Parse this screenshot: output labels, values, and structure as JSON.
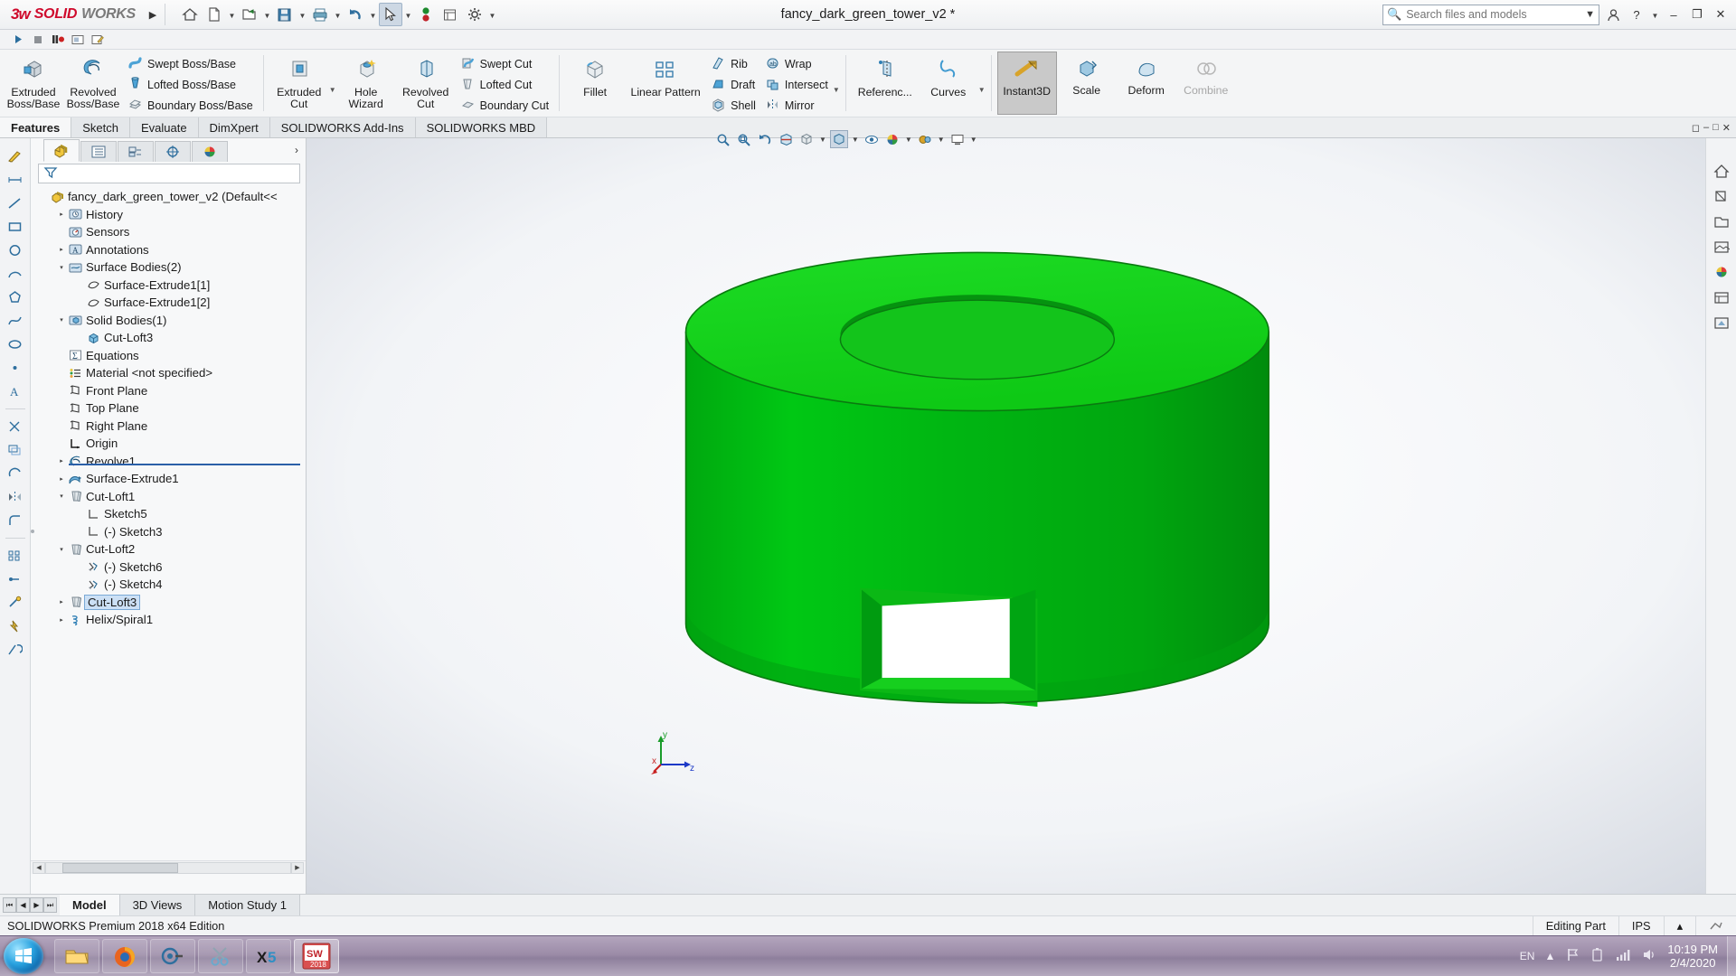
{
  "titlebar": {
    "brand_ds": "35",
    "brand_solid": "SOLID",
    "brand_works": "WORKS",
    "document_title": "fancy_dark_green_tower_v2 *",
    "icons": [
      "home-icon",
      "new-document-icon",
      "open-folder-icon",
      "save-icon",
      "print-icon",
      "undo-icon",
      "select-pointer-icon",
      "stop-record-icon",
      "display-icon",
      "options-gear-icon"
    ],
    "search_placeholder": "Search files and models",
    "user_label": "",
    "help_label": "?",
    "minimize": "–",
    "maximize": "❐",
    "close": "✕"
  },
  "minibar": {
    "icons": [
      "play-icon",
      "stop-icon",
      "pause-record-icon",
      "screen-capture-icon",
      "edit-macro-icon"
    ]
  },
  "ribbon": {
    "groups": [
      {
        "name": "features-create",
        "big": [
          {
            "label_line1": "Extruded",
            "label_line2": "Boss/Base",
            "icon": "extruded-boss-icon"
          },
          {
            "label_line1": "Revolved",
            "label_line2": "Boss/Base",
            "icon": "revolved-boss-icon"
          }
        ],
        "small": [
          {
            "label": "Swept Boss/Base",
            "icon": "swept-boss-icon"
          },
          {
            "label": "Lofted Boss/Base",
            "icon": "lofted-boss-icon"
          },
          {
            "label": "Boundary Boss/Base",
            "icon": "boundary-boss-icon"
          }
        ]
      },
      {
        "name": "features-cut",
        "big": [
          {
            "label_line1": "Extruded",
            "label_line2": "Cut",
            "icon": "extruded-cut-icon"
          },
          {
            "label_line1": "Hole Wizard",
            "label_line2": "",
            "icon": "hole-wizard-icon"
          },
          {
            "label_line1": "Revolved",
            "label_line2": "Cut",
            "icon": "revolved-cut-icon"
          }
        ],
        "small": [
          {
            "label": "Swept Cut",
            "icon": "swept-cut-icon"
          },
          {
            "label": "Lofted Cut",
            "icon": "lofted-cut-icon"
          },
          {
            "label": "Boundary Cut",
            "icon": "boundary-cut-icon"
          }
        ]
      },
      {
        "name": "features-modify",
        "big": [
          {
            "label_line1": "Fillet",
            "label_line2": "",
            "icon": "fillet-icon"
          },
          {
            "label_line1": "Linear Pattern",
            "label_line2": "",
            "icon": "linear-pattern-icon"
          }
        ],
        "small": [
          {
            "label": "Rib",
            "icon": "rib-icon"
          },
          {
            "label": "Draft",
            "icon": "draft-icon"
          },
          {
            "label": "Shell",
            "icon": "shell-icon"
          }
        ],
        "small2": [
          {
            "label": "Wrap",
            "icon": "wrap-icon"
          },
          {
            "label": "Intersect",
            "icon": "intersect-icon"
          },
          {
            "label": "Mirror",
            "icon": "mirror-icon"
          }
        ]
      },
      {
        "name": "features-reference",
        "big": [
          {
            "label_line1": "Referenc...",
            "label_line2": "",
            "icon": "reference-geometry-icon"
          },
          {
            "label_line1": "Curves",
            "label_line2": "",
            "icon": "curves-icon"
          }
        ],
        "small": []
      },
      {
        "name": "features-direct",
        "big": [
          {
            "label_line1": "Instant3D",
            "label_line2": "",
            "icon": "instant3d-icon",
            "selected": true
          },
          {
            "label_line1": "Scale",
            "label_line2": "",
            "icon": "scale-icon"
          },
          {
            "label_line1": "Deform",
            "label_line2": "",
            "icon": "deform-icon"
          },
          {
            "label_line1": "Combine",
            "label_line2": "",
            "icon": "combine-icon",
            "disabled": true
          }
        ],
        "small": []
      }
    ]
  },
  "tabs": {
    "items": [
      "Features",
      "Sketch",
      "Evaluate",
      "DimXpert",
      "SOLIDWORKS Add-Ins",
      "SOLIDWORKS MBD"
    ],
    "active_index": 0,
    "window_controls": [
      "restore-down-icon",
      "minimize-icon",
      "maximize-icon",
      "close-icon"
    ]
  },
  "viewbar": {
    "icons": [
      "zoom-to-fit-icon",
      "zoom-area-icon",
      "previous-view-icon",
      "section-view-icon",
      "view-orientation-icon",
      "display-style-icon",
      "hide-show-icon",
      "apply-scene-icon",
      "view-settings-icon",
      "viewport-icon"
    ]
  },
  "left_rail": {
    "icons": [
      "sketch-icon",
      "smart-dimension-icon",
      "line-icon",
      "rectangle-icon",
      "circle-icon",
      "arc-icon",
      "polygon-icon",
      "spline-icon",
      "ellipse-icon",
      "point-icon",
      "text-icon",
      "trim-icon",
      "offset-icon",
      "convert-entities-icon",
      "mirror-entities-icon",
      "fillet-sketch-icon",
      "linear-sketch-pattern-icon",
      "display-delete-relations-icon",
      "repair-sketch-icon",
      "quick-snaps-icon",
      "rapid-sketch-icon"
    ]
  },
  "feature_manager": {
    "tabs": [
      "featuremanager-design-tree-icon",
      "property-manager-icon",
      "configuration-manager-icon",
      "dimxpert-manager-icon",
      "display-manager-icon"
    ],
    "active_tab": 0,
    "more_icon": "chevron-right-icon",
    "filter_icon": "filter-funnel-icon",
    "tree": [
      {
        "indent": 0,
        "twisty": "",
        "icon": "part-icon",
        "label": "fancy_dark_green_tower_v2  (Default<<",
        "selected": false
      },
      {
        "indent": 1,
        "twisty": "▸",
        "icon": "history-icon",
        "label": "History",
        "selected": false
      },
      {
        "indent": 1,
        "twisty": "",
        "icon": "sensors-icon",
        "label": "Sensors",
        "selected": false
      },
      {
        "indent": 1,
        "twisty": "▸",
        "icon": "annotations-icon",
        "label": "Annotations",
        "selected": false
      },
      {
        "indent": 1,
        "twisty": "▾",
        "icon": "surface-bodies-folder-icon",
        "label": "Surface Bodies(2)",
        "selected": false
      },
      {
        "indent": 2,
        "twisty": "",
        "icon": "surface-body-icon",
        "label": "Surface-Extrude1[1]",
        "selected": false
      },
      {
        "indent": 2,
        "twisty": "",
        "icon": "surface-body-icon",
        "label": "Surface-Extrude1[2]",
        "selected": false
      },
      {
        "indent": 1,
        "twisty": "▾",
        "icon": "solid-bodies-folder-icon",
        "label": "Solid Bodies(1)",
        "selected": false
      },
      {
        "indent": 2,
        "twisty": "",
        "icon": "solid-body-icon",
        "label": "Cut-Loft3",
        "selected": false
      },
      {
        "indent": 1,
        "twisty": "",
        "icon": "equations-icon",
        "label": "Equations",
        "selected": false
      },
      {
        "indent": 1,
        "twisty": "",
        "icon": "material-icon",
        "label": "Material <not specified>",
        "selected": false
      },
      {
        "indent": 1,
        "twisty": "",
        "icon": "plane-icon",
        "label": "Front Plane",
        "selected": false
      },
      {
        "indent": 1,
        "twisty": "",
        "icon": "plane-icon",
        "label": "Top Plane",
        "selected": false
      },
      {
        "indent": 1,
        "twisty": "",
        "icon": "plane-icon",
        "label": "Right Plane",
        "selected": false
      },
      {
        "indent": 1,
        "twisty": "",
        "icon": "origin-icon",
        "label": "Origin",
        "selected": false
      },
      {
        "indent": 1,
        "twisty": "▸",
        "icon": "revolve-icon",
        "label": "Revolve1",
        "selected": false
      },
      {
        "indent": 1,
        "twisty": "▸",
        "icon": "surface-extrude-icon",
        "label": "Surface-Extrude1",
        "selected": false
      },
      {
        "indent": 1,
        "twisty": "▾",
        "icon": "cut-loft-icon",
        "label": "Cut-Loft1",
        "selected": false
      },
      {
        "indent": 2,
        "twisty": "",
        "icon": "sketch-flat-icon",
        "label": "Sketch5",
        "selected": false
      },
      {
        "indent": 2,
        "twisty": "",
        "icon": "sketch-flat-icon",
        "label": "(-) Sketch3",
        "selected": false
      },
      {
        "indent": 1,
        "twisty": "▾",
        "icon": "cut-loft-icon",
        "label": "Cut-Loft2",
        "selected": false
      },
      {
        "indent": 2,
        "twisty": "",
        "icon": "sketch-3d-icon",
        "label": "(-) Sketch6",
        "selected": false
      },
      {
        "indent": 2,
        "twisty": "",
        "icon": "sketch-3d-icon",
        "label": "(-) Sketch4",
        "selected": false
      },
      {
        "indent": 1,
        "twisty": "▸",
        "icon": "cut-loft-icon",
        "label": "Cut-Loft3",
        "selected": true
      },
      {
        "indent": 1,
        "twisty": "▸",
        "icon": "helix-icon",
        "label": "Helix/Spiral1",
        "selected": false
      }
    ],
    "scrollbar": {
      "left_arrow": "◀",
      "right_arrow": "▶"
    }
  },
  "graphics": {
    "model_name": "fancy_dark_green_tower_v2",
    "model_color": "#00b412",
    "model_color_top": "#13d91e",
    "model_color_shadow": "#009110",
    "triad": {
      "x_label": "x",
      "y_label": "y",
      "z_label": "z"
    }
  },
  "right_rail": {
    "icons": [
      "home-view-icon",
      "appearances-icon",
      "decals-icon",
      "scenes-icon",
      "lights-icon",
      "cameras-icon",
      "walkthrough-icon",
      "custom-views-icon"
    ]
  },
  "bottom_tabs": {
    "nav_icons": [
      "first-tab-icon",
      "prev-tab-icon",
      "next-tab-icon",
      "last-tab-icon"
    ],
    "items": [
      "Model",
      "3D Views",
      "Motion Study 1"
    ],
    "active_index": 0
  },
  "statusbar": {
    "left": "SOLIDWORKS Premium 2018 x64 Edition",
    "editing_state": "Editing Part",
    "units": "IPS",
    "expand_caret": "▴",
    "sync_icon": "rebuild-icon"
  },
  "taskbar": {
    "start_label": "start-orb",
    "tasks": [
      "explorer-icon",
      "firefox-icon",
      "visual-studio-icon",
      "snipping-tool-icon",
      "x5-icon",
      "solidworks-icon"
    ],
    "active_task_index": 5,
    "solidworks_badge": "2018",
    "tray": {
      "language": "EN",
      "icons": [
        "show-hidden-icons-caret",
        "flag-action-center-icon",
        "battery-icon",
        "network-icon",
        "volume-icon"
      ],
      "time": "10:19 PM",
      "date": "2/4/2020"
    }
  }
}
